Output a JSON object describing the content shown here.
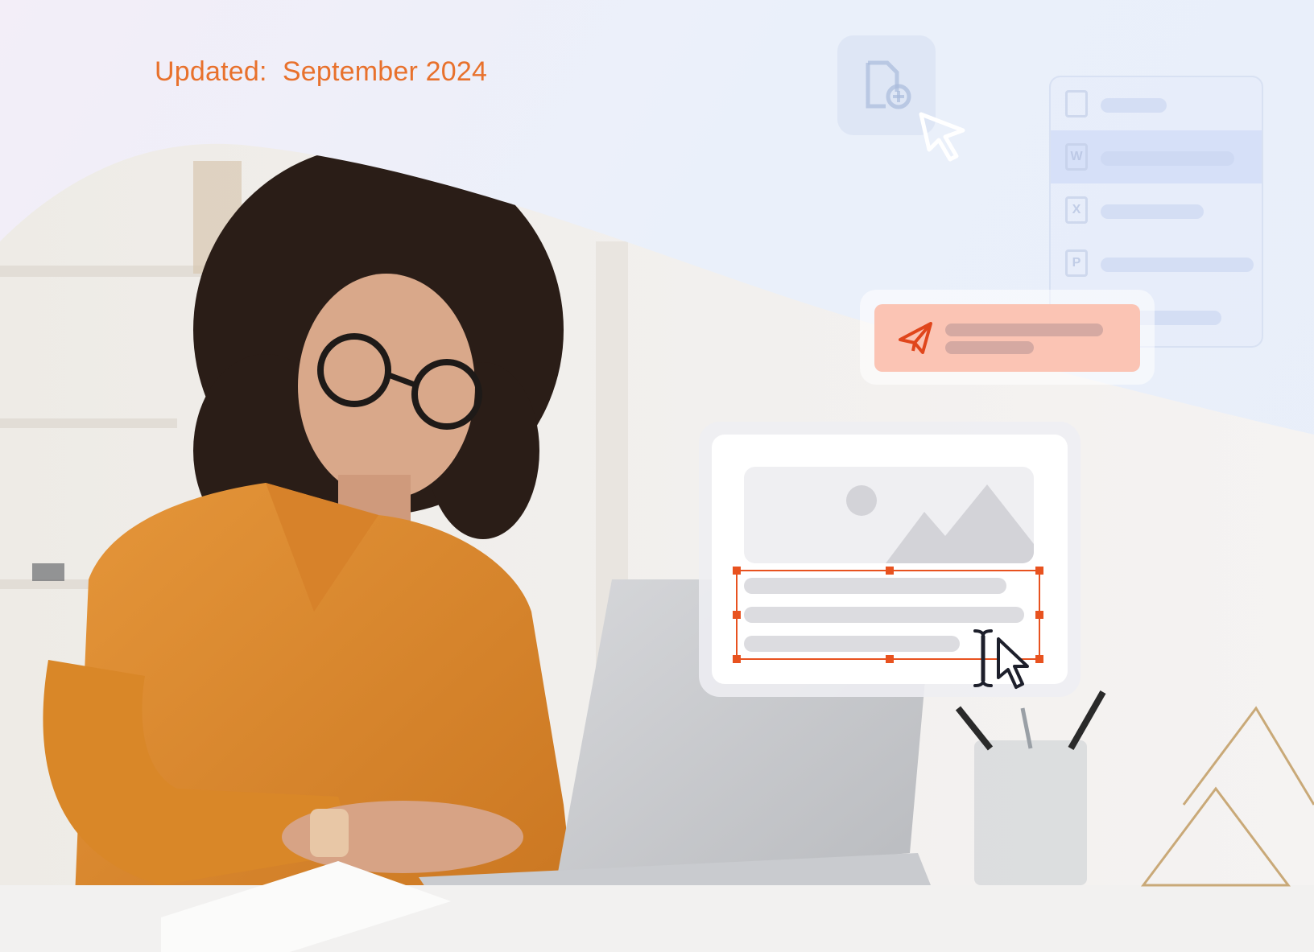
{
  "header": {
    "updated_label": "Updated:",
    "updated_date": "September 2024"
  },
  "colors": {
    "accent": "#e8712c",
    "selection": "#e8521f",
    "send_bg": "#fbc4b4",
    "background": "#eaf0fa"
  },
  "icons": {
    "upload": "file-plus-icon",
    "top_cursor": "cursor-arrow-icon",
    "send": "paper-plane-icon",
    "image": "image-placeholder-icon",
    "text_cursor": "i-beam-icon",
    "pointer": "cursor-arrow-icon"
  },
  "file_list": {
    "items": [
      {
        "type_letter": "",
        "icon": "document-icon"
      },
      {
        "type_letter": "W",
        "icon": "word-file-icon"
      },
      {
        "type_letter": "X",
        "icon": "excel-file-icon"
      },
      {
        "type_letter": "P",
        "icon": "powerpoint-file-icon"
      },
      {
        "type_letter": "",
        "icon": "file-icon"
      }
    ]
  }
}
